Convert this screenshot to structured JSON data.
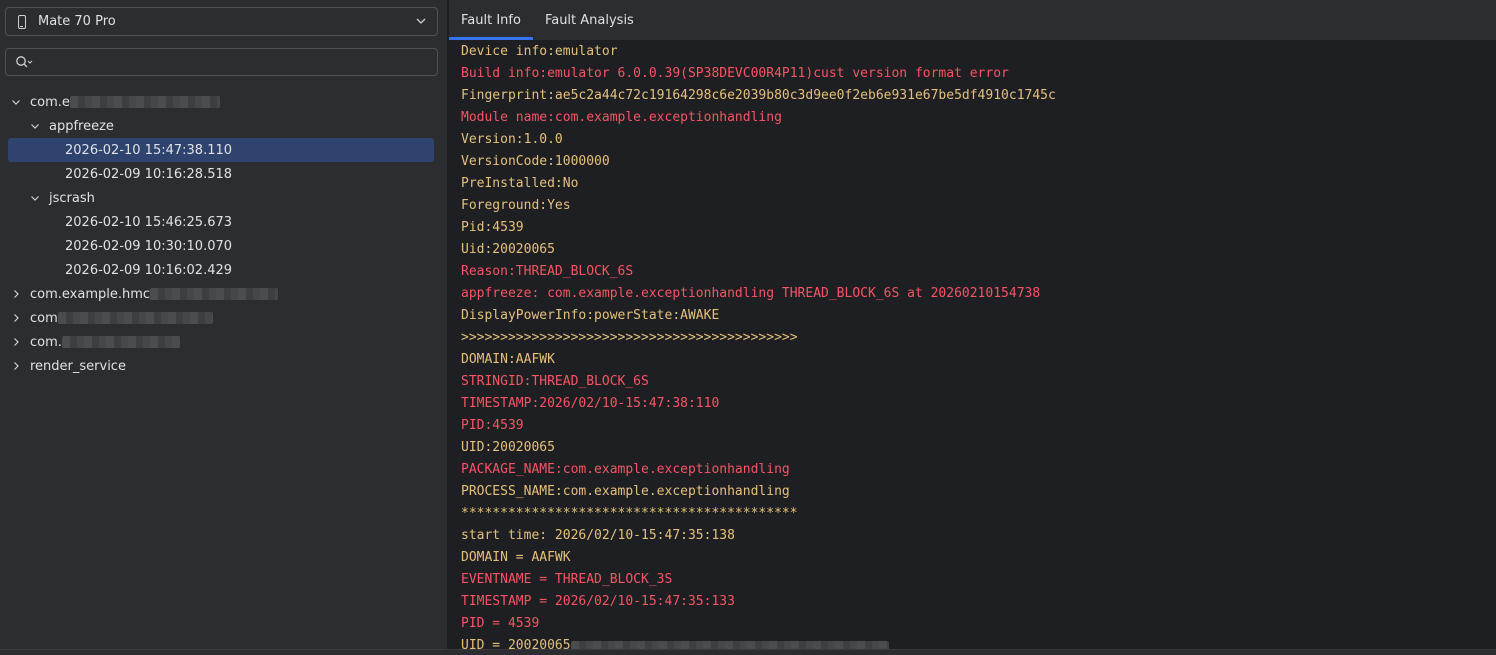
{
  "device": {
    "name": "Mate 70 Pro"
  },
  "search": {
    "placeholder": "",
    "value": ""
  },
  "tree": [
    {
      "label": "com.e",
      "level": 0,
      "expanded": true,
      "redacted": true
    },
    {
      "label": "appfreeze",
      "level": 1,
      "expanded": true
    },
    {
      "label": "2026-02-10 15:47:38.110",
      "level": 2,
      "selected": true
    },
    {
      "label": "2026-02-09 10:16:28.518",
      "level": 2
    },
    {
      "label": "jscrash",
      "level": 1,
      "expanded": true
    },
    {
      "label": "2026-02-10 15:46:25.673",
      "level": 2
    },
    {
      "label": "2026-02-09 10:30:10.070",
      "level": 2
    },
    {
      "label": "2026-02-09 10:16:02.429",
      "level": 2
    },
    {
      "label": "com.example.hmc",
      "level": 0,
      "expanded": false,
      "redacted": true
    },
    {
      "label": "com",
      "level": 0,
      "expanded": false,
      "redacted": true
    },
    {
      "label": "com.",
      "level": 0,
      "expanded": false,
      "redacted": true
    },
    {
      "label": "render_service",
      "level": 0,
      "expanded": false
    }
  ],
  "tabs": {
    "fault_info": "Fault Info",
    "fault_analysis": "Fault Analysis",
    "active": "Fault Info"
  },
  "colors": {
    "accent": "#3574f0",
    "selected_row": "#2e436e",
    "log_yellow": "#e5c07b",
    "log_red": "#f75464"
  },
  "log_lines": [
    {
      "text": "Device info:emulator",
      "color": "y"
    },
    {
      "text": "Build info:emulator 6.0.0.39(SP38DEVC00R4P11)cust version format error",
      "color": "r"
    },
    {
      "text": "Fingerprint:ae5c2a44c72c19164298c6e2039b80c3d9ee0f2eb6e931e67be5df4910c1745c",
      "color": "y"
    },
    {
      "text": "Module name:com.example.exceptionhandling",
      "color": "r"
    },
    {
      "text": "Version:1.0.0",
      "color": "y"
    },
    {
      "text": "VersionCode:1000000",
      "color": "y"
    },
    {
      "text": "PreInstalled:No",
      "color": "y"
    },
    {
      "text": "Foreground:Yes",
      "color": "y"
    },
    {
      "text": "Pid:4539",
      "color": "y"
    },
    {
      "text": "Uid:20020065",
      "color": "y"
    },
    {
      "text": "Reason:THREAD_BLOCK_6S",
      "color": "r"
    },
    {
      "text": "appfreeze: com.example.exceptionhandling THREAD_BLOCK_6S at 20260210154738",
      "color": "r"
    },
    {
      "text": "DisplayPowerInfo:powerState:AWAKE",
      "color": "y"
    },
    {
      "text": ">>>>>>>>>>>>>>>>>>>>>>>>>>>>>>>>>>>>>>>>>>>",
      "color": "y"
    },
    {
      "text": "DOMAIN:AAFWK",
      "color": "y"
    },
    {
      "text": "STRINGID:THREAD_BLOCK_6S",
      "color": "r"
    },
    {
      "text": "TIMESTAMP:2026/02/10-15:47:38:110",
      "color": "r"
    },
    {
      "text": "PID:4539",
      "color": "r"
    },
    {
      "text": "UID:20020065",
      "color": "y"
    },
    {
      "text": "PACKAGE_NAME:com.example.exceptionhandling",
      "color": "r"
    },
    {
      "text": "PROCESS_NAME:com.example.exceptionhandling",
      "color": "y"
    },
    {
      "text": "*******************************************",
      "color": "y"
    },
    {
      "text": "start time: 2026/02/10-15:47:35:138",
      "color": "y"
    },
    {
      "text": "DOMAIN = AAFWK",
      "color": "y"
    },
    {
      "text": "EVENTNAME = THREAD_BLOCK_3S",
      "color": "r"
    },
    {
      "text": "TIMESTAMP = 2026/02/10-15:47:35:133",
      "color": "r"
    },
    {
      "text": "PID = 4539",
      "color": "r"
    },
    {
      "text": "UID = 20020065",
      "color": "y"
    }
  ]
}
